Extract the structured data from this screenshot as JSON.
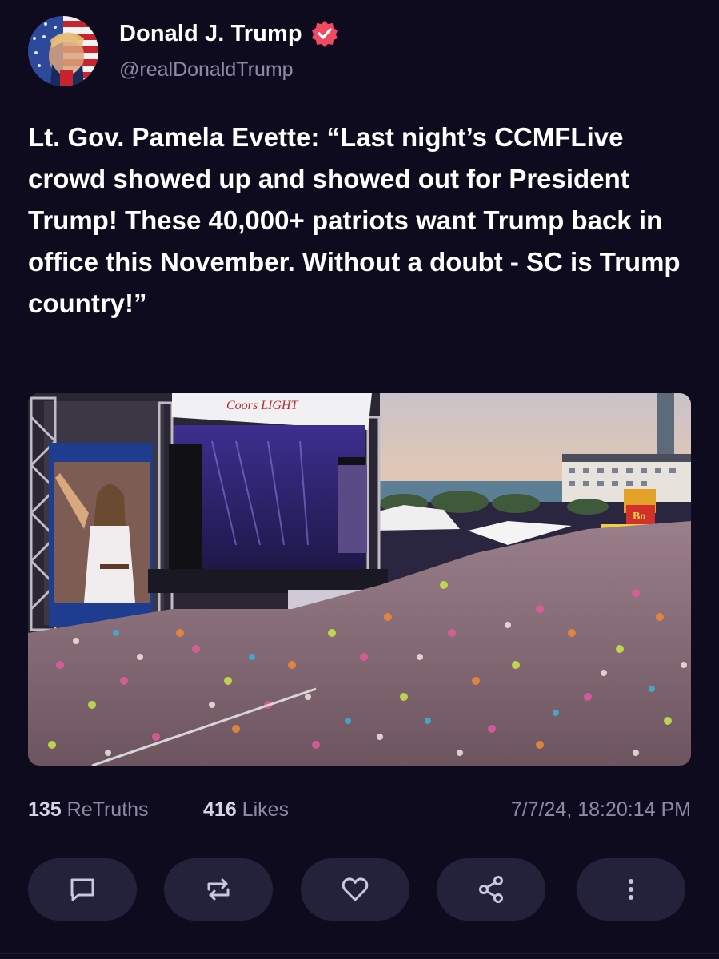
{
  "author": {
    "display_name": "Donald J. Trump",
    "handle": "@realDonaldTrump",
    "verified_color": "#f04b63",
    "avatar_icon": "profile-avatar"
  },
  "post": {
    "text": "Lt. Gov. Pamela Evette: “Last night’s CCMFLive crowd showed up and showed out for President Trump! These 40,000+ patriots want Trump back in office this November. Without a doubt - SC is Trump country!”",
    "media": {
      "kind": "photo",
      "banner_text": "Coors LIGHT",
      "sign_text": "Bo"
    }
  },
  "stats": {
    "retruths_count": "135",
    "retruths_label": "ReTruths",
    "likes_count": "416",
    "likes_label": "Likes",
    "timestamp": "7/7/24, 18:20:14 PM"
  },
  "actions": [
    {
      "name": "reply",
      "icon": "comment-icon"
    },
    {
      "name": "retruth",
      "icon": "repost-icon"
    },
    {
      "name": "like",
      "icon": "heart-icon"
    },
    {
      "name": "share",
      "icon": "share-icon"
    },
    {
      "name": "more",
      "icon": "more-vertical-icon"
    }
  ],
  "colors": {
    "background": "#0e0b1f",
    "button_bg": "#24213a",
    "muted_text": "#8e8aa6",
    "icon_color": "#c9c6e0"
  }
}
